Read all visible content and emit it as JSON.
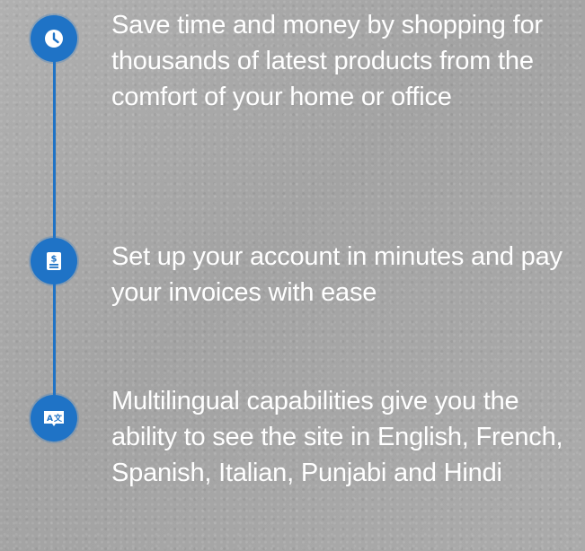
{
  "colors": {
    "accent": "#1f73c6",
    "text": "#ffffff",
    "background": "#a9a9a9"
  },
  "features": [
    {
      "icon": "clock-icon",
      "text": "Save time and money by shopping for thousands of latest products from the comfort of your home or office"
    },
    {
      "icon": "invoice-dollar-icon",
      "text": "Set up your account in minutes and pay your invoices with ease"
    },
    {
      "icon": "translate-icon",
      "text": "Multilingual capabilities give you the ability to see the site in English, French, Spanish, Italian, Punjabi and Hindi"
    }
  ]
}
